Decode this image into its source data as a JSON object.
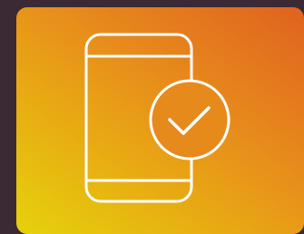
{
  "icon": {
    "name": "smartphone-check-icon",
    "stroke_color": "#ffffff"
  },
  "tile": {
    "gradient_start": "#e6d20c",
    "gradient_mid": "#e8a614",
    "gradient_end": "#e0621f"
  },
  "frame": {
    "background": "#3b2a34"
  }
}
